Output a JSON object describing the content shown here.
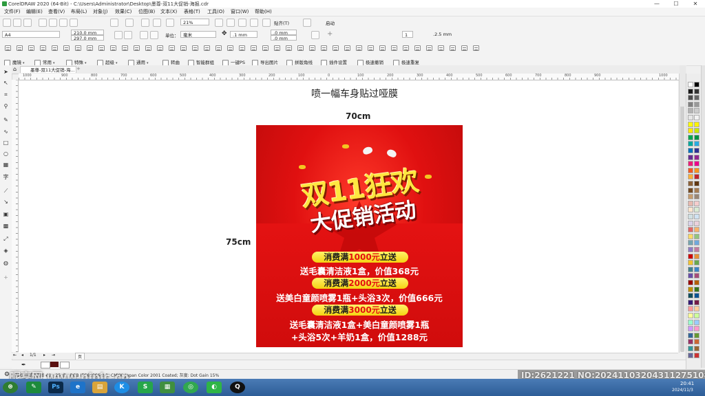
{
  "window": {
    "title": "CorelDRAW 2020 (64-Bit) - C:\\Users\\Administrator\\Desktop\\墨尊-双11大促销-海报.cdr",
    "minimize": "—",
    "maximize": "☐",
    "close": "✕"
  },
  "menu": [
    "文件(F)",
    "编辑(E)",
    "查看(V)",
    "布局(L)",
    "对象(J)",
    "效果(C)",
    "位图(B)",
    "文本(X)",
    "表格(T)",
    "工具(O)",
    "窗口(W)",
    "帮助(H)"
  ],
  "standard_toolbar": {
    "zoom": "21%",
    "snap_label": "贴齐(T)",
    "launch_label": "启动"
  },
  "property_bar": {
    "page_size": "A4",
    "width": "210.0 mm",
    "height": "297.0 mm",
    "units_label": "单位：",
    "units_value": "毫米",
    "nudge": ".1 mm",
    "dup_x": ".0 mm",
    "dup_y": ".0 mm",
    "page_num": "1",
    "outline": ".2.5 mm"
  },
  "macro_bar": [
    {
      "label": "魔镜",
      "dropdown": true
    },
    {
      "label": "常用",
      "dropdown": true
    },
    {
      "label": "特殊",
      "dropdown": true
    },
    {
      "label": "超级",
      "dropdown": true
    },
    {
      "label": "通用",
      "dropdown": true
    },
    {
      "label": "转曲",
      "dropdown": false
    },
    {
      "label": "智能群组",
      "dropdown": false
    },
    {
      "label": "一键PS",
      "dropdown": false
    },
    {
      "label": "导出图片",
      "dropdown": false
    },
    {
      "label": "拼版角线",
      "dropdown": false
    },
    {
      "label": "插件设置",
      "dropdown": false
    },
    {
      "label": "极速撤销",
      "dropdown": false
    },
    {
      "label": "极速重复",
      "dropdown": false
    }
  ],
  "document_tab": {
    "label": "墨尊-双11大促销-海...",
    "close": "✕",
    "add": "+"
  },
  "ruler_labels": [
    "1000",
    "900",
    "800",
    "700",
    "600",
    "500",
    "400",
    "300",
    "200",
    "100",
    "0",
    "100",
    "200",
    "300",
    "400",
    "500",
    "600",
    "700",
    "800",
    "900",
    "1000"
  ],
  "canvas_notes": {
    "heading": "喷一幅车身贴过哑膜",
    "width_label": "70cm",
    "height_label": "75cm"
  },
  "poster": {
    "headline1": "双11狂欢",
    "headline2": "大促销活动",
    "offers": [
      {
        "pill_pre": "消费满",
        "pill_amount": "1000元",
        "pill_post": "立送",
        "lines": [
          "送毛囊清洁液1盒，价值368元"
        ]
      },
      {
        "pill_pre": "消费满",
        "pill_amount": "2000元",
        "pill_post": "立送",
        "lines": [
          "送美白童颜喷雾1瓶+头浴3次，价值666元"
        ]
      },
      {
        "pill_pre": "消费满",
        "pill_amount": "3000元",
        "pill_post": "立送",
        "lines": [
          "送毛囊清洁液1盒+美白童颜喷雾1瓶",
          "+头浴5次+羊奶1盒，价值1288元"
        ]
      }
    ],
    "colors": {
      "red": "#d90f0f",
      "yellow": "#ffe640",
      "pill": "#f5d311",
      "amount": "#e4120f"
    }
  },
  "page_bar": {
    "label": "页1",
    "counter": "1/1"
  },
  "status": {
    "left_text": "JPEG 模式 (位图 #1 · 25 点 · RGB IEC61966-2.1; CMYK: Japan Color 2001 Coated; 灰度: Dot Gain 15%"
  },
  "watermark": {
    "left": "昵享网 www.nipic.cn",
    "right": "ID:2621221 NO:20241103204311275108"
  },
  "taskbar": {
    "apps": [
      {
        "icon": "start-orb-icon",
        "label": "⊛"
      },
      {
        "icon": "coreldraw-icon",
        "label": "✎"
      },
      {
        "icon": "photoshop-icon",
        "label": "Ps"
      },
      {
        "icon": "ie-icon",
        "label": "e"
      },
      {
        "icon": "folder-icon",
        "label": "▤"
      },
      {
        "icon": "kugou-icon",
        "label": "K"
      },
      {
        "icon": "spreadsheet-icon",
        "label": "S"
      },
      {
        "icon": "chart-app-icon",
        "label": "▦"
      },
      {
        "icon": "360-browser-icon",
        "label": "◎"
      },
      {
        "icon": "wechat-icon",
        "label": "◐"
      },
      {
        "icon": "qq-icon",
        "label": "Q"
      }
    ],
    "time": "20:41",
    "date": "2024/11/3"
  },
  "palette_colors": [
    "#ffffff",
    "#000000",
    "#1a1a1a",
    "#333333",
    "#4d4d4d",
    "#666666",
    "#808080",
    "#999999",
    "#b3b3b3",
    "#cccccc",
    "#e6e6e6",
    "#f2f2f2",
    "#ffff00",
    "#fff200",
    "#ffe600",
    "#c8e600",
    "#00a651",
    "#009245",
    "#00a99d",
    "#29abe2",
    "#0071bc",
    "#2e3192",
    "#662d91",
    "#92278f",
    "#ed1e79",
    "#ec008c",
    "#f15a24",
    "#f7931e",
    "#fbb03b",
    "#c1272d",
    "#8c6239",
    "#603813",
    "#754c24",
    "#a67c52",
    "#c69c6d",
    "#998675",
    "#e6b8af",
    "#f4cccc",
    "#fce5cd",
    "#d9ead3",
    "#d0e0e3",
    "#cfe2f3",
    "#d9d2e9",
    "#ead1dc",
    "#e06666",
    "#f6b26b",
    "#ffd966",
    "#93c47d",
    "#76a5af",
    "#6fa8dc",
    "#8e7cc3",
    "#c27ba0",
    "#cc0000",
    "#e69138",
    "#f1c232",
    "#6aa84f",
    "#45818e",
    "#3d85c6",
    "#674ea7",
    "#a64d79",
    "#990000",
    "#b45f06",
    "#bf9000",
    "#38761d",
    "#134f5c",
    "#0b5394",
    "#351c75",
    "#741b47",
    "#ff9999",
    "#ffcc99",
    "#ffff99",
    "#ccff99",
    "#99ffcc",
    "#99ccff",
    "#cc99ff",
    "#ff99cc",
    "#336699",
    "#669933",
    "#993366",
    "#cc6633",
    "#339999",
    "#996633",
    "#666699",
    "#cc3333"
  ]
}
